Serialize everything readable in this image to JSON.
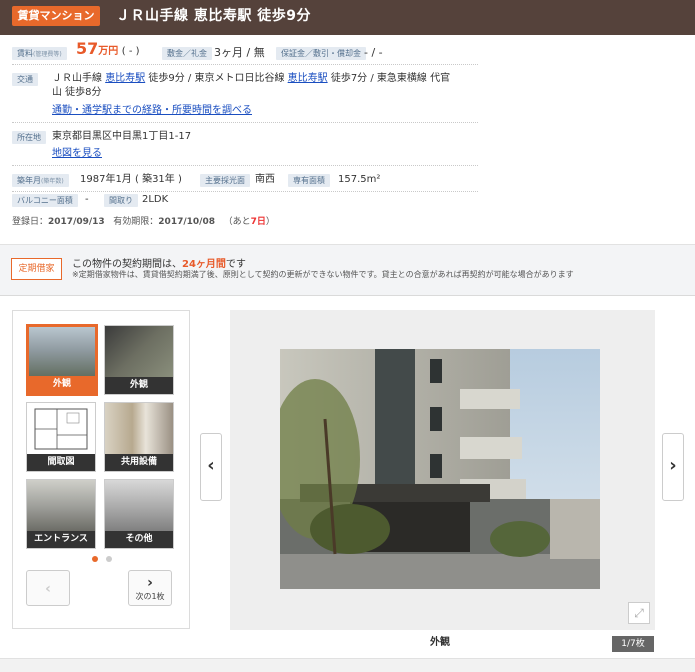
{
  "header": {
    "category": "賃貸マンション",
    "title": "ＪＲ山手線 恵比寿駅 徒歩9分"
  },
  "rent": {
    "label": "賃料",
    "label_sub": "(管理費等)",
    "price": "57",
    "unit": "万円",
    "mgmt": "( - )",
    "deposit_label": "敷金／礼金",
    "deposit_value": "3ヶ月 / 無",
    "guarantee_label": "保証金／敷引・償却金",
    "guarantee_value": "- / -"
  },
  "traffic": {
    "label": "交通",
    "line1_pre": "ＪＲ山手線 ",
    "line1_link1": "恵比寿駅",
    "line1_mid": " 徒歩9分 / 東京メトロ日比谷線 ",
    "line1_link2": "恵比寿駅",
    "line1_post": " 徒歩7分 / 東急東横線 代官",
    "line2": "山 徒歩8分",
    "route_link": "通勤・通学駅までの経路・所要時間を調べる"
  },
  "address": {
    "label": "所在地",
    "value": "東京都目黒区中目黒1丁目1-17",
    "map_link": "地図を見る"
  },
  "details": {
    "built_label": "築年月",
    "built_sub": "(築年数)",
    "built_value": "1987年1月 ( 築31年 )",
    "light_label": "主要採光面",
    "light_value": "南西",
    "area_label": "専有面積",
    "area_value": "157.5m²",
    "balcony_label": "バルコニー面積",
    "balcony_value": "-",
    "layout_label": "間取り",
    "layout_value": "2LDK"
  },
  "dates": {
    "reg_label": "登録日：",
    "reg_value": "2017/09/13",
    "exp_label": "有効期限：",
    "exp_value": "2017/10/08",
    "remain_pre": "（あと",
    "remain_days": "7日",
    "remain_post": "）"
  },
  "lease": {
    "badge": "定期借家",
    "text_pre": "この物件の契約期間は、",
    "text_em": "24ヶ月間",
    "text_post": "です",
    "note": "※定期借家物件は、賃貸借契約期満了後、原則として契約の更新ができない物件です。貸主との合意があれば再契約が可能な場合があります"
  },
  "gallery": {
    "thumbs": [
      {
        "caption": "外観"
      },
      {
        "caption": "外観"
      },
      {
        "caption": "間取図"
      },
      {
        "caption": "共用設備"
      },
      {
        "caption": "エントランス"
      },
      {
        "caption": "その他"
      }
    ],
    "next_label": "次の1枚",
    "caption": "外観",
    "counter": "1/7枚"
  },
  "colors": {
    "header_bg": "#55423b",
    "accent": "#e8692b",
    "link": "#1a4ec0",
    "label_bg": "#e4eaf1"
  }
}
